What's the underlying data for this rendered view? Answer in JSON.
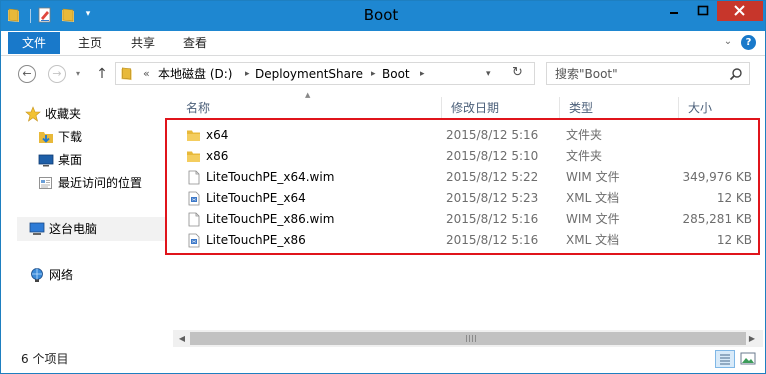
{
  "window": {
    "title": "Boot"
  },
  "ribbon": {
    "file_tab": "文件",
    "tabs": [
      "主页",
      "共享",
      "查看"
    ]
  },
  "address": {
    "overflow": "«",
    "breadcrumbs": [
      "本地磁盘 (D:)",
      "DeploymentShare",
      "Boot"
    ]
  },
  "search": {
    "placeholder": "搜索\"Boot\""
  },
  "navigation": {
    "favorites_label": "收藏夹",
    "favorites": [
      "下载",
      "桌面",
      "最近访问的位置"
    ],
    "this_pc": "这台电脑",
    "network": "网络"
  },
  "columns": {
    "name": "名称",
    "date": "修改日期",
    "type": "类型",
    "size": "大小"
  },
  "files": [
    {
      "name": "x64",
      "date": "2015/8/12 5:16",
      "type": "文件夹",
      "size": "",
      "icon": "folder-icon"
    },
    {
      "name": "x86",
      "date": "2015/8/12 5:10",
      "type": "文件夹",
      "size": "",
      "icon": "folder-icon"
    },
    {
      "name": "LiteTouchPE_x64.wim",
      "date": "2015/8/12 5:22",
      "type": "WIM 文件",
      "size": "349,976 KB",
      "icon": "file-icon"
    },
    {
      "name": "LiteTouchPE_x64",
      "date": "2015/8/12 5:23",
      "type": "XML 文档",
      "size": "12 KB",
      "icon": "xml-file-icon"
    },
    {
      "name": "LiteTouchPE_x86.wim",
      "date": "2015/8/12 5:16",
      "type": "WIM 文件",
      "size": "285,281 KB",
      "icon": "file-icon"
    },
    {
      "name": "LiteTouchPE_x86",
      "date": "2015/8/12 5:16",
      "type": "XML 文档",
      "size": "12 KB",
      "icon": "xml-file-icon"
    }
  ],
  "status": {
    "item_count": "6 个项目"
  },
  "colors": {
    "titlebar": "#1e87d1",
    "file_tab": "#1979ca",
    "close_button": "#c7362b",
    "highlight_border": "#e0141b",
    "folder": "#e8b93a",
    "column_header_text": "#4c607a"
  }
}
